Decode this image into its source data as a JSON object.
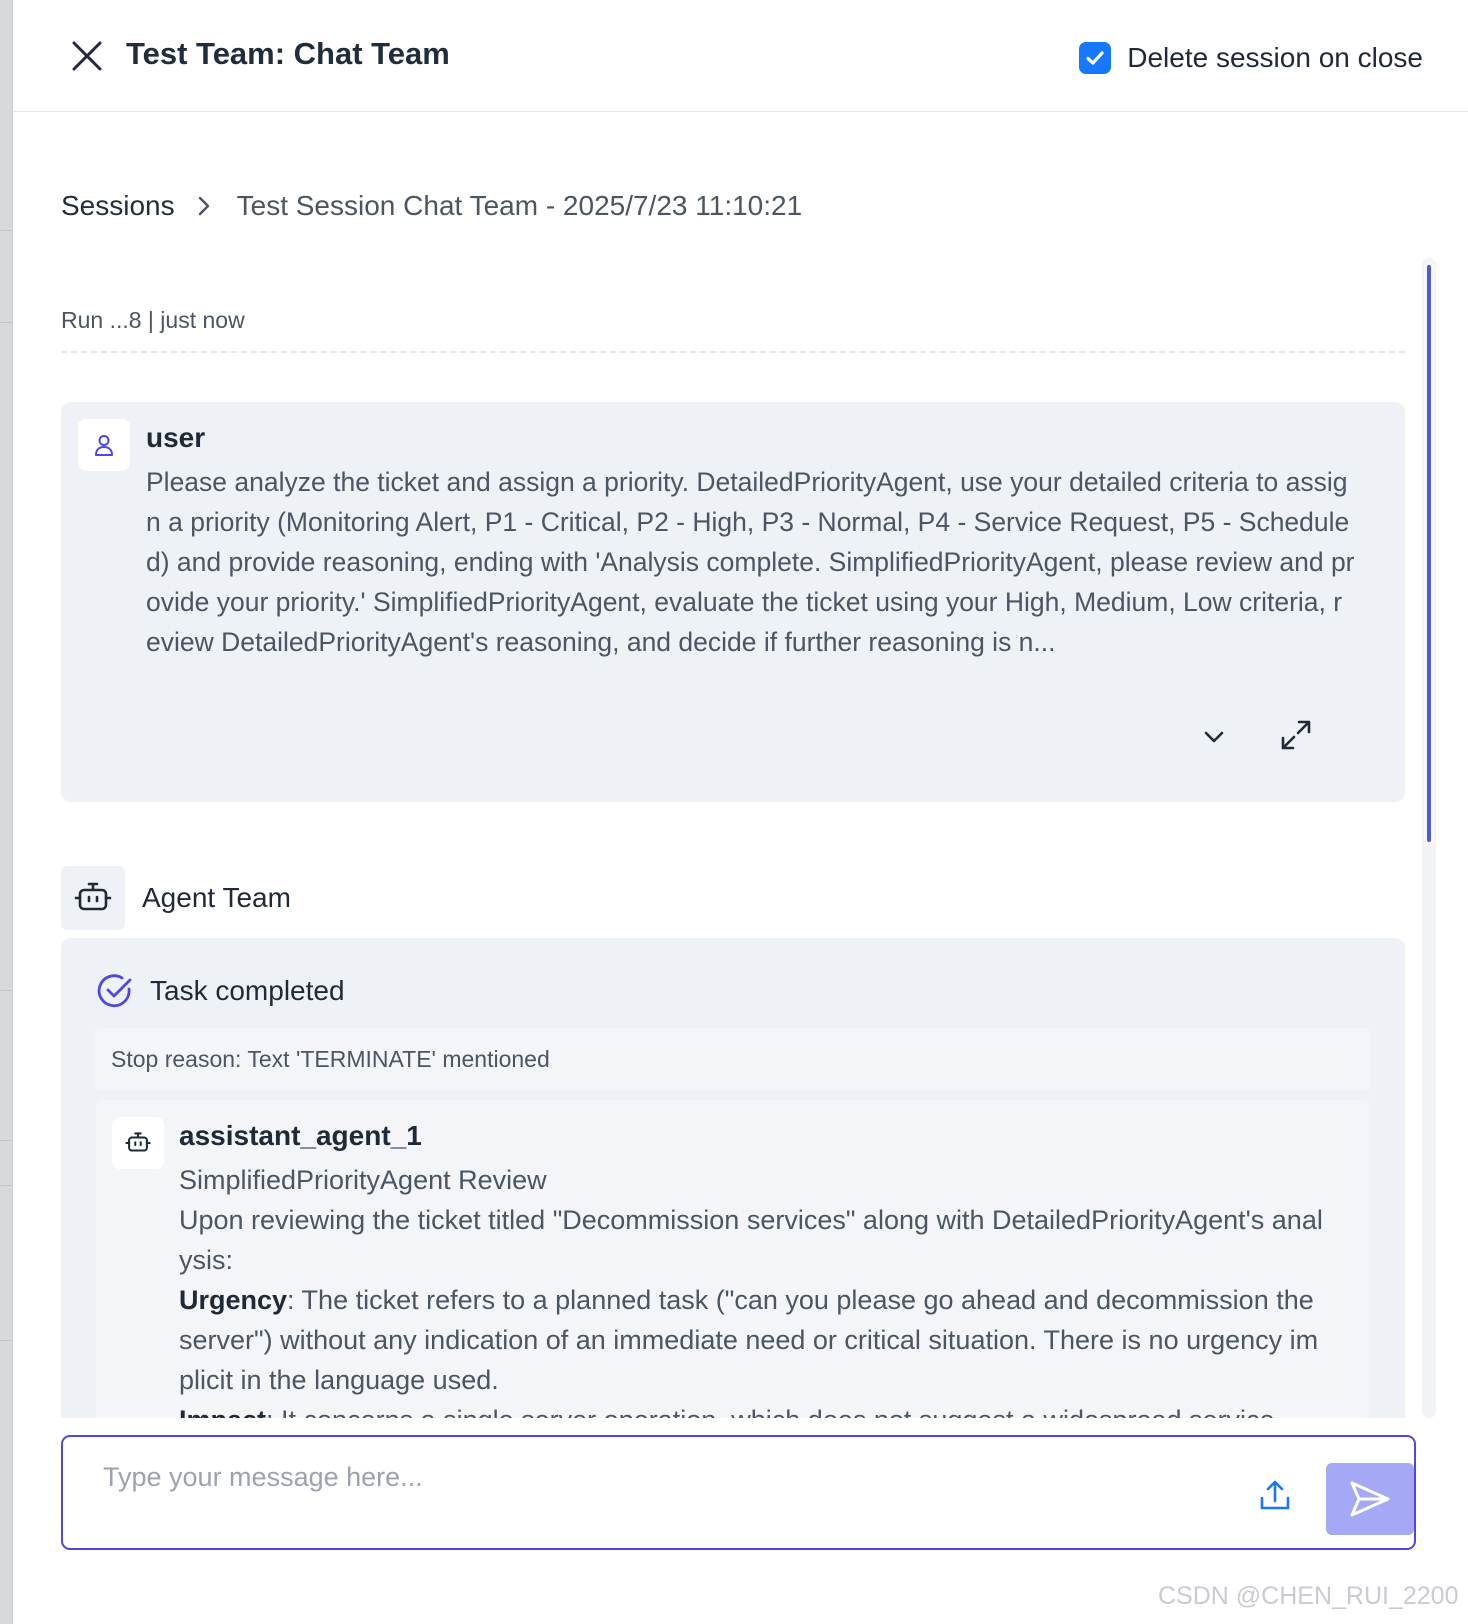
{
  "header": {
    "title": "Test Team: Chat Team",
    "delete_on_close_label": "Delete session on close",
    "delete_on_close_checked": true
  },
  "breadcrumb": {
    "root": "Sessions",
    "current": "Test Session Chat Team - 2025/7/23 11:10:21"
  },
  "run": {
    "meta": "Run ...8 | just now"
  },
  "user_message": {
    "sender": "user",
    "text": "Please analyze the ticket and assign a priority. DetailedPriorityAgent, use your detailed criteria to assign a priority (Monitoring Alert, P1 - Critical, P2 - High, P3 - Normal, P4 - Service Request, P5 - Scheduled) and provide reasoning, ending with 'Analysis complete. SimplifiedPriorityAgent, please review and provide your priority.' SimplifiedPriorityAgent, evaluate the ticket using your High, Medium, Low criteria, review DetailedPriorityAgent's reasoning, and decide if further reasoning is n..."
  },
  "agent_team": {
    "label": "Agent Team",
    "status": "Task completed",
    "stop_reason": "Stop reason: Text 'TERMINATE' mentioned",
    "message": {
      "sender": "assistant_agent_1",
      "line1": "SimplifiedPriorityAgent Review",
      "line2": "Upon reviewing the ticket titled \"Decommission services\" along with DetailedPriorityAgent's analysis:",
      "urgency_label": "Urgency",
      "urgency_text": ": The ticket refers to a planned task (\"can you please go ahead and decommission the server\") without any indication of an immediate need or critical situation. There is no urgency implicit in the language used.",
      "impact_label": "Impact",
      "impact_text": ": It concerns a single server operation, which does not suggest a widespread service"
    }
  },
  "composer": {
    "placeholder": "Type your message here..."
  },
  "watermark": "CSDN @CHEN_RUI_2200",
  "colors": {
    "accent": "#4f46e5",
    "checkbox": "#1677ff",
    "send_button": "#a5a8f4",
    "card_bg": "#eef1f5"
  },
  "icons": {
    "close": "close-icon",
    "checkbox": "check-icon",
    "breadcrumb_separator": "chevron-right-icon",
    "user_avatar": "user-icon",
    "collapse": "chevron-down-icon",
    "expand": "expand-icon",
    "team_avatar": "bot-icon",
    "task_status": "check-circle-icon",
    "agent_avatar": "bot-icon",
    "upload": "upload-icon",
    "send": "send-icon"
  }
}
